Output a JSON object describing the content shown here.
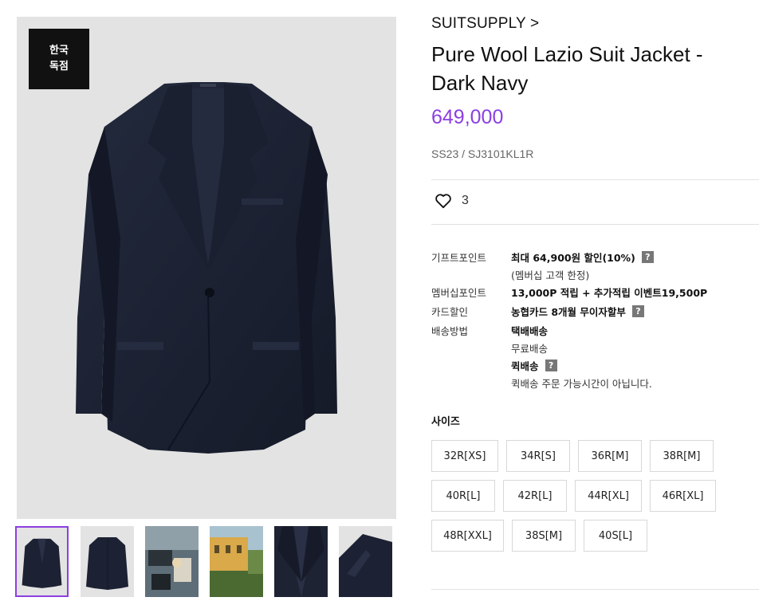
{
  "product": {
    "badge": "한국\n독점",
    "brand": "SUITSUPPLY >",
    "title": "Pure Wool Lazio Suit Jacket - Dark Navy",
    "price": "649,000",
    "code": "SS23 / SJ3101KL1R",
    "likes": "3"
  },
  "colors": {
    "accent": "#8b3fe0",
    "badge_bg": "#111111",
    "jacket": "#1c2133"
  },
  "details": {
    "gift_label": "기프트포인트",
    "gift_value": "최대 64,900원 할인(10%)",
    "gift_note": "(멤버십 고객 한정)",
    "member_label": "멤버십포인트",
    "member_value": "13,000P 적립 + 추가적립 이벤트19,500P",
    "card_label": "카드할인",
    "card_value": "농협카드 8개월 무이자할부",
    "ship_label": "배송방법",
    "ship_value1": "택배배송",
    "ship_value2": "무료배송",
    "ship_value3": "퀵배송",
    "ship_value4": "퀵배송 주문 가능시간이 아닙니다.",
    "help_icon": "?"
  },
  "sizes": {
    "title": "사이즈",
    "options": [
      "32R[XS]",
      "34R[S]",
      "36R[M]",
      "38R[M]",
      "40R[L]",
      "42R[L]",
      "44R[XL]",
      "46R[XL]",
      "48R[XXL]",
      "38S[M]",
      "40S[L]"
    ]
  },
  "thumbnails": [
    "jacket-front",
    "jacket-back",
    "workshop-photo",
    "villa-photo",
    "lapel-closeup",
    "shoulder-closeup"
  ],
  "icons": {
    "like": "heart-icon",
    "help": "question-icon"
  }
}
